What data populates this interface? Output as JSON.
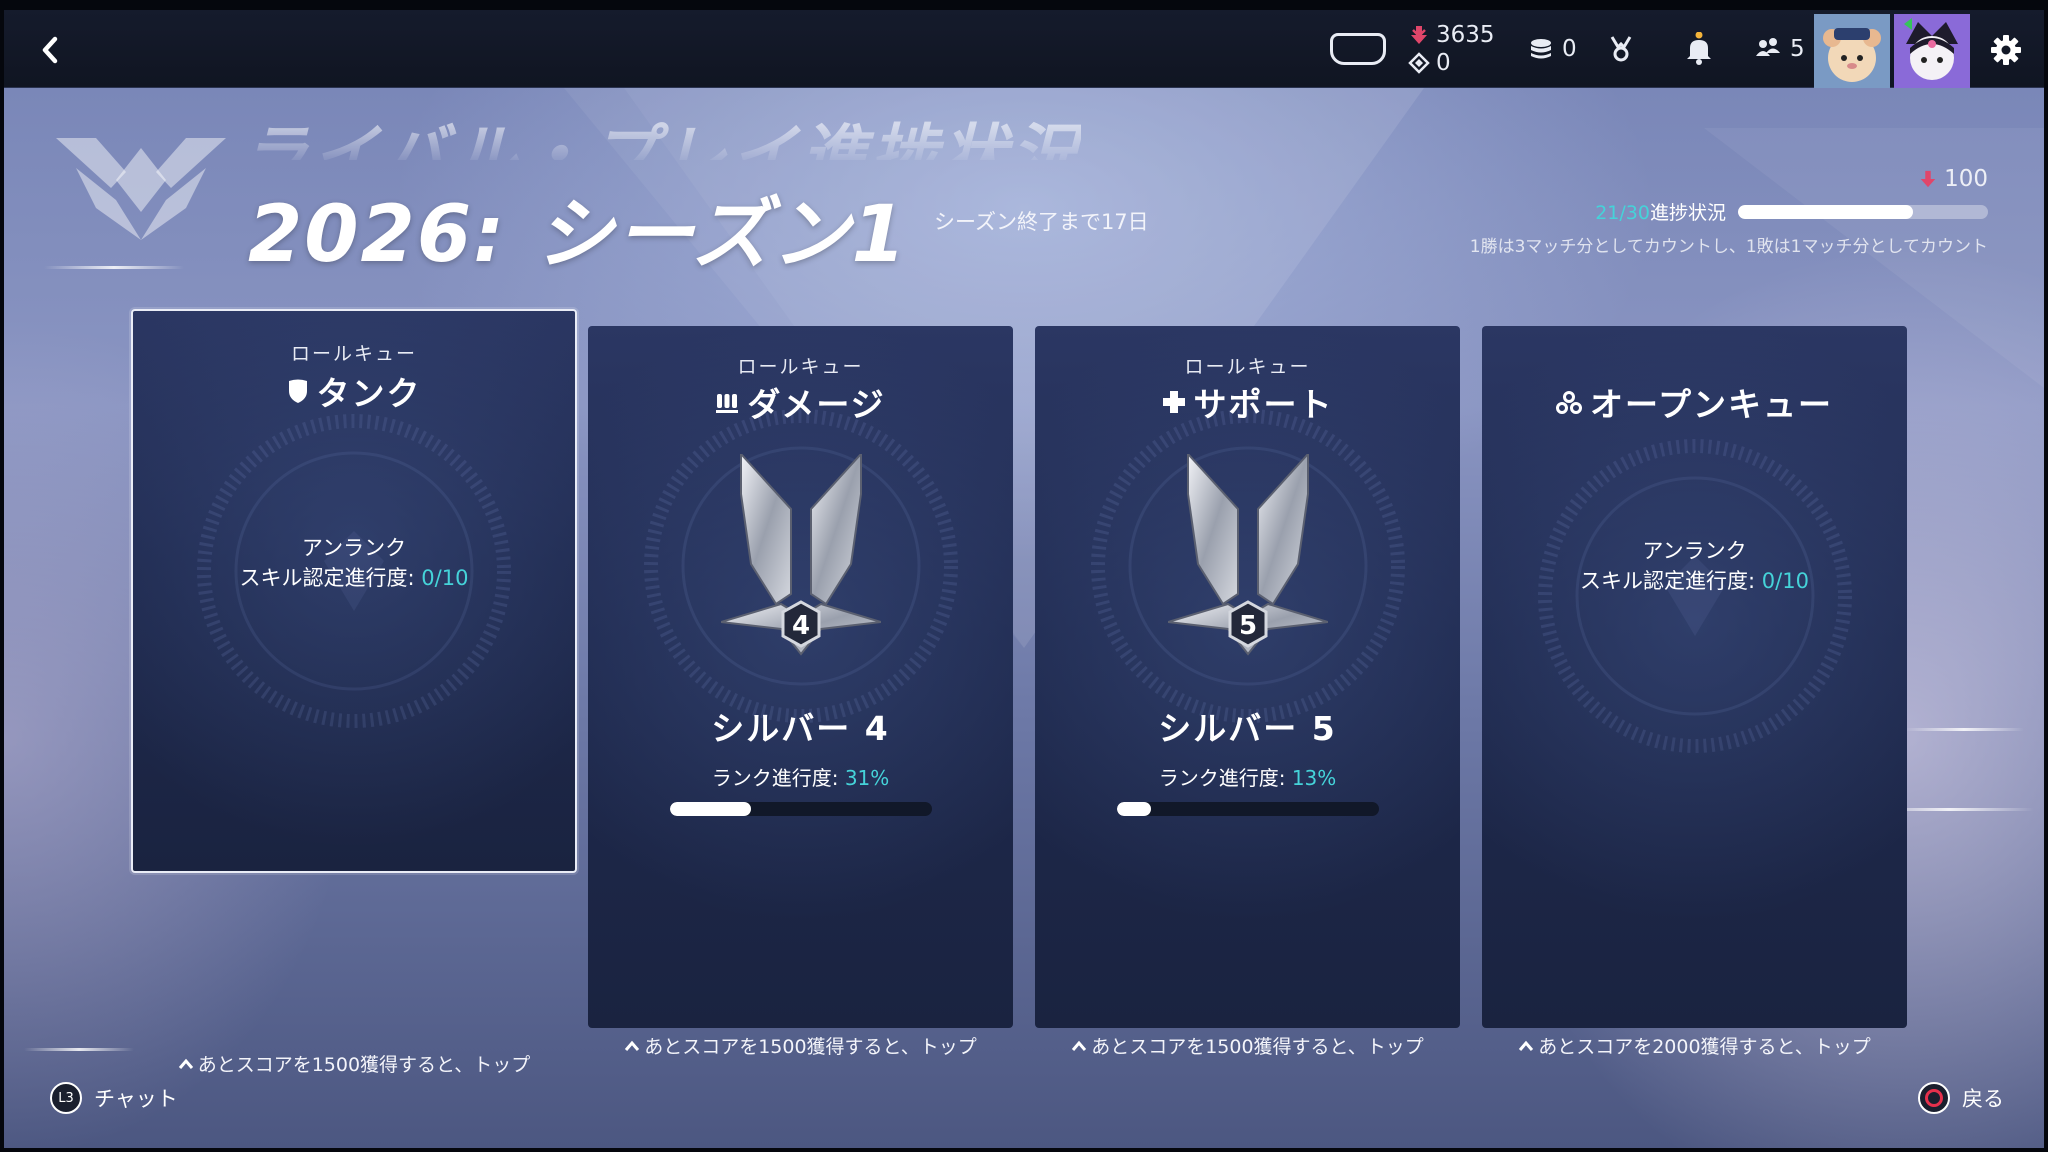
{
  "topbar": {
    "back_icon": "chevron-left-icon",
    "currency_primary_icon": "competitive-points-icon",
    "currency_primary": "3635",
    "currency_secondary_icon": "legacy-points-icon",
    "currency_secondary": "0",
    "coins_icon": "coins-icon",
    "coins": "0",
    "medal_icon": "medal-icon",
    "bell_icon": "bell-icon",
    "friends_icon": "friends-icon",
    "friends_online": "5",
    "settings_icon": "gear-icon"
  },
  "header": {
    "heading": "ライバル・プレイ進捗状況",
    "season_title": "2026: シーズン1",
    "season_remaining": "シーズン終了まで17日",
    "reward_amount": "100",
    "match_progress_count": "21/30",
    "match_progress_label": "進捗状況",
    "match_progress_fraction": 0.7,
    "match_note": "1勝は3マッチ分としてカウントし、1敗は1マッチ分としてカウント"
  },
  "cards": [
    {
      "queue_label": "ロールキュー",
      "role_icon": "tank-shield-icon",
      "role_name": "タンク",
      "status": "アンランク",
      "placement_label": "スキル認定進行度:",
      "placement_value": "0/10",
      "footer": "あとスコアを1500獲得すると、トップ",
      "selected": true
    },
    {
      "queue_label": "ロールキュー",
      "role_icon": "damage-bullets-icon",
      "role_name": "ダメージ",
      "rank_name": "シルバー 4",
      "rank_division": "4",
      "rank_progress_label": "ランク進行度:",
      "rank_progress_value": "31%",
      "rank_progress_fraction": 0.31,
      "footer": "あとスコアを1500獲得すると、トップ"
    },
    {
      "queue_label": "ロールキュー",
      "role_icon": "support-cross-icon",
      "role_name": "サポート",
      "rank_name": "シルバー 5",
      "rank_division": "5",
      "rank_progress_label": "ランク進行度:",
      "rank_progress_value": "13%",
      "rank_progress_fraction": 0.13,
      "footer": "あとスコアを1500獲得すると、トップ"
    },
    {
      "role_icon": "open-queue-icon",
      "role_name": "オープンキュー",
      "status": "アンランク",
      "placement_label": "スキル認定進行度:",
      "placement_value": "0/10",
      "footer": "あとスコアを2000獲得すると、トップ"
    }
  ],
  "bottom": {
    "chat_button": "L3",
    "chat_label": "チャット",
    "back_label": "戻る"
  },
  "colors": {
    "accent_cyan": "#45d3d9",
    "currency_pink": "#e0466a",
    "card_bg": "#1f2a4f",
    "back_button_red": "#e5304c"
  }
}
